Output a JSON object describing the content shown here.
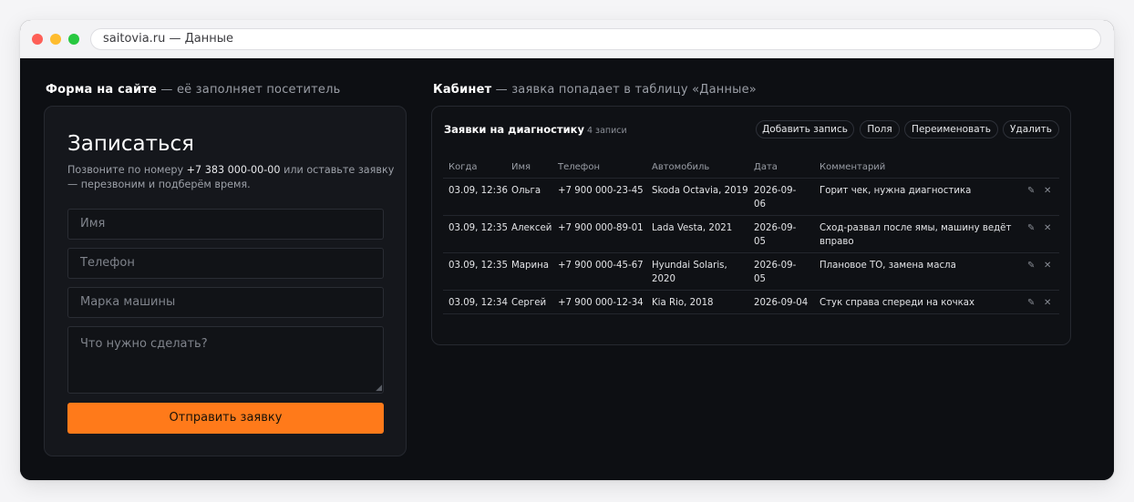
{
  "browser": {
    "url": "saitovia.ru — Данные"
  },
  "left_section": {
    "title_bold": "Форма на сайте",
    "title_rest": " — её заполняет посетитель"
  },
  "right_section": {
    "title_bold": "Кабинет",
    "title_rest": " — заявка попадает в таблицу «Данные»"
  },
  "form": {
    "heading": "Записаться",
    "subtitle_before": "Позвоните по номеру ",
    "subtitle_phone": "+7 383 000-00-00",
    "subtitle_after": " или оставьте заявку — перезвоним и подберём время.",
    "name_placeholder": "Имя",
    "phone_placeholder": "Телефон",
    "car_placeholder": "Марка машины",
    "need_placeholder": "Что нужно сделать?",
    "submit_label": "Отправить заявку"
  },
  "table": {
    "title": "Заявки на диагностику",
    "count": "4 записи",
    "buttons": {
      "add": "Добавить запись",
      "fields": "Поля",
      "rename": "Переименовать",
      "delete": "Удалить"
    },
    "columns": [
      "Когда",
      "Имя",
      "Телефон",
      "Автомобиль",
      "Дата",
      "Комментарий"
    ],
    "rows": [
      [
        "03.09, 12:36",
        "Ольга",
        "+7 900 000-23-45",
        "Skoda Octavia, 2019",
        "2026-09-06",
        "Горит чек, нужна диагностика"
      ],
      [
        "03.09, 12:35",
        "Алексей",
        "+7 900 000-89-01",
        "Lada Vesta, 2021",
        "2026-09-05",
        "Сход-развал после ямы, машину ведёт вправо"
      ],
      [
        "03.09, 12:35",
        "Марина",
        "+7 900 000-45-67",
        "Hyundai Solaris, 2020",
        "2026-09-05",
        "Плановое ТО, замена масла"
      ],
      [
        "03.09, 12:34",
        "Сергей",
        "+7 900 000-12-34",
        "Kia Rio, 2018",
        "2026-09-04",
        "Стук справа спереди на кочках"
      ]
    ],
    "edit_icon": "✎",
    "delete_icon": "✕"
  },
  "colors": {
    "accent": "#ff7a1a",
    "background": "#0d0f13",
    "card": "#15171c"
  }
}
